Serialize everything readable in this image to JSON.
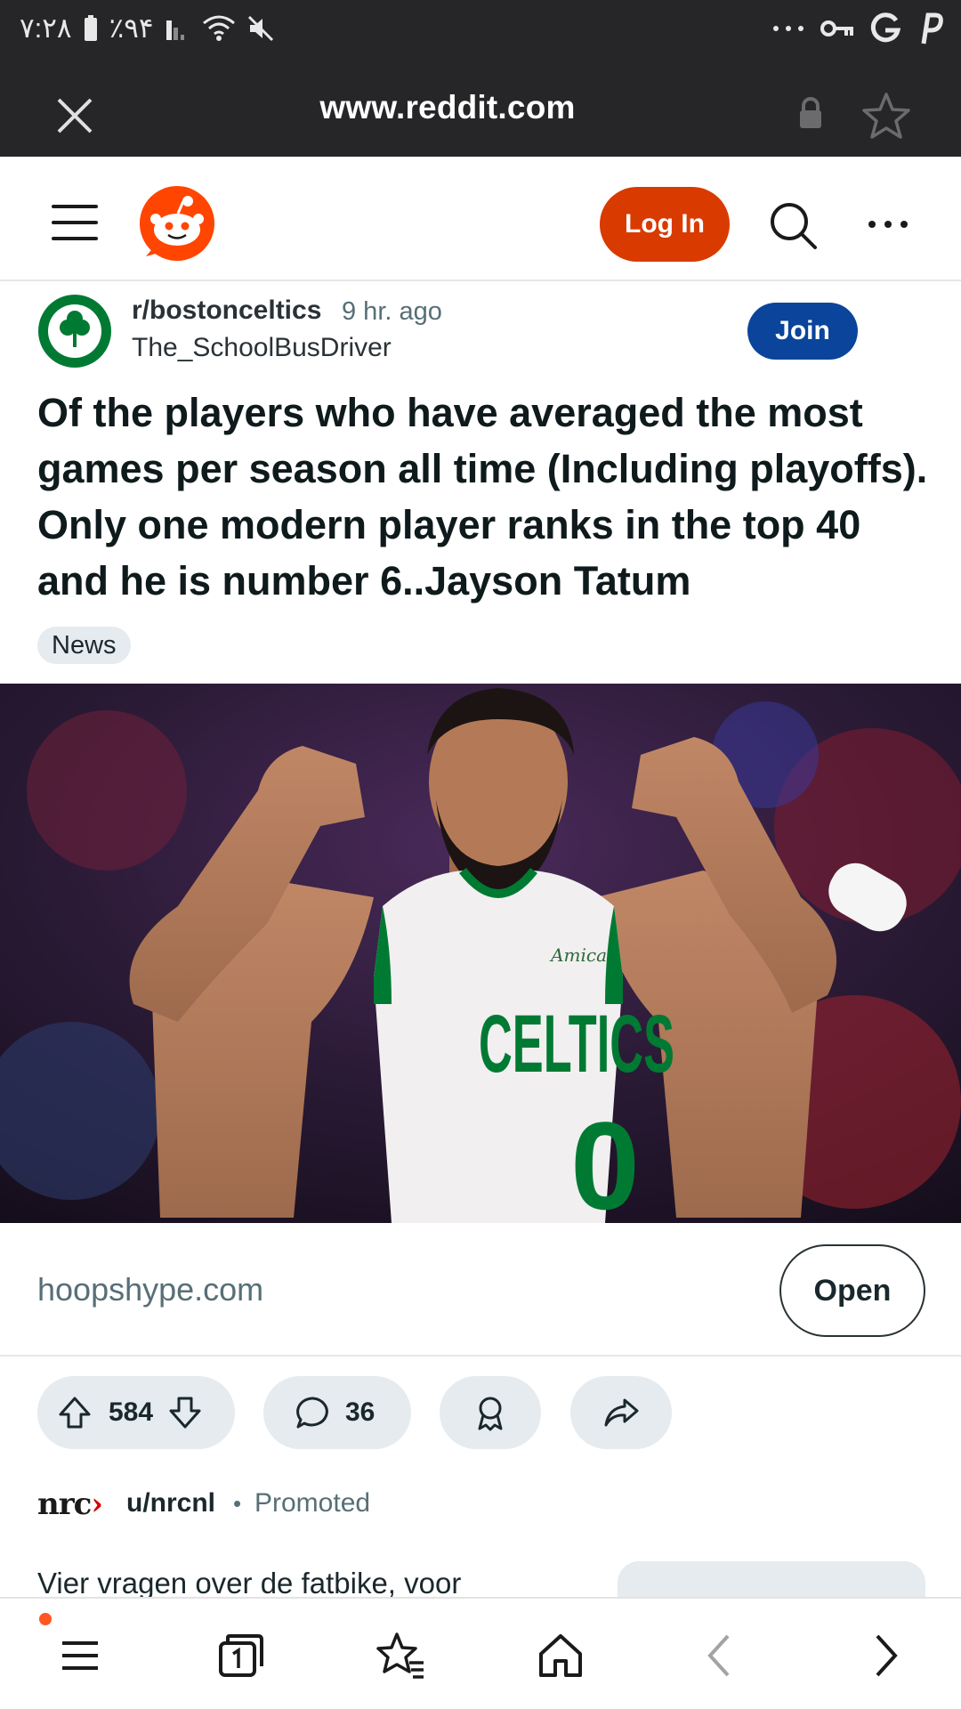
{
  "status_bar": {
    "time": "۷:۲۸",
    "battery": "٪۹۴",
    "icons": [
      "battery-icon",
      "signal-icon",
      "wifi-icon",
      "mute-icon",
      "more-dots-icon",
      "key-icon",
      "google-icon",
      "paypal-icon"
    ]
  },
  "browser": {
    "url": "www.reddit.com",
    "load_progress": 0.46
  },
  "header": {
    "login_label": "Log In"
  },
  "post": {
    "subreddit": "r/bostonceltics",
    "time_ago": "9 hr. ago",
    "author": "The_SchoolBusDriver",
    "join_label": "Join",
    "title": "Of the players who have averaged the most games per season all time (Including playoffs). Only one modern player ranks in the top 40 and he is number 6..Jayson Tatum",
    "flair": "News",
    "image_jersey_sponsor": "Amica",
    "image_jersey_team": "CELTICS",
    "image_jersey_number": "0",
    "link_domain": "hoopshype.com",
    "open_label": "Open",
    "score": "584",
    "comments": "36"
  },
  "promoted": {
    "logo": "nrc",
    "logo_arrow": "›",
    "user": "u/nrcnl",
    "separator": "•",
    "label": "Promoted",
    "text": "Vier vragen over de fatbike, voor"
  },
  "colors": {
    "reddit_orange": "#ff4500",
    "login_button": "#d93a00",
    "join_button": "#0a449b",
    "celtics_green": "#007a33"
  }
}
